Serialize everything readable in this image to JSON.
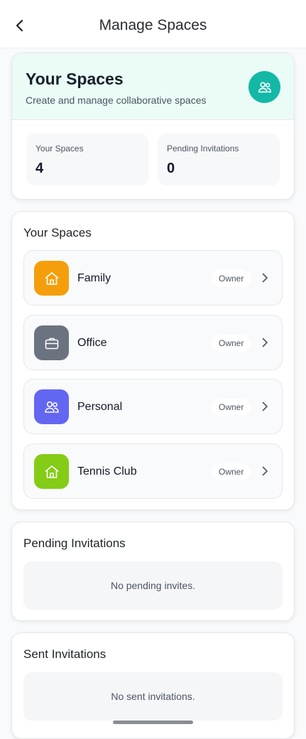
{
  "header": {
    "title": "Manage Spaces",
    "back_icon": "chevron-left-icon"
  },
  "hero": {
    "title": "Your Spaces",
    "subtitle": "Create and manage collaborative spaces",
    "icon": "users-icon",
    "accent": "#14b8a6",
    "stats": [
      {
        "label": "Your Spaces",
        "value": "4"
      },
      {
        "label": "Pending Invitations",
        "value": "0"
      }
    ]
  },
  "spaces_section": {
    "title": "Your Spaces",
    "items": [
      {
        "name": "Family",
        "role": "Owner",
        "icon": "home-icon",
        "color": "#f59e0b"
      },
      {
        "name": "Office",
        "role": "Owner",
        "icon": "briefcase-icon",
        "color": "#6b7280"
      },
      {
        "name": "Personal",
        "role": "Owner",
        "icon": "users-icon",
        "color": "#6366f1"
      },
      {
        "name": "Tennis Club",
        "role": "Owner",
        "icon": "home-icon",
        "color": "#84cc16"
      }
    ]
  },
  "pending_section": {
    "title": "Pending Invitations",
    "empty_text": "No pending invites."
  },
  "sent_section": {
    "title": "Sent Invitations",
    "empty_text": "No sent invitations."
  }
}
